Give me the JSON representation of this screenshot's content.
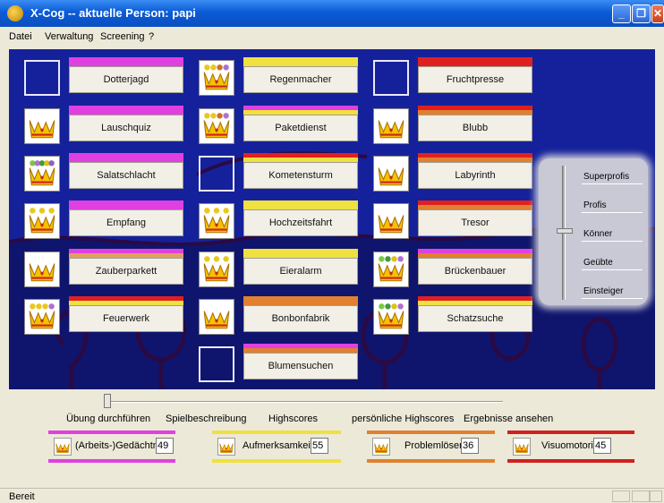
{
  "window": {
    "title": "X-Cog -- aktuelle Person: papi"
  },
  "menu": [
    "Datei",
    "Verwaltung",
    "Screening",
    "?"
  ],
  "games": [
    {
      "label": "Dotterjagd",
      "crown": false,
      "dots": [],
      "bars": [
        "#e040e0",
        "#e040e0"
      ]
    },
    {
      "label": "Lauschquiz",
      "crown": true,
      "dots": [],
      "bars": [
        "#e040e0",
        "#e040e0"
      ]
    },
    {
      "label": "Salatschlacht",
      "crown": true,
      "dots": [
        "#7ac943",
        "#b070d0",
        "#3c9c3c",
        "#e0c020",
        "#9060c0"
      ],
      "bars": [
        "#e040e0",
        "#e040e0"
      ]
    },
    {
      "label": "Empfang",
      "crown": true,
      "dots": [
        "#e8c820",
        "#e8c820",
        "#e8c820"
      ],
      "bars": [
        "#e040e0",
        "#e040e0"
      ]
    },
    {
      "label": "Zauberparkett",
      "crown": true,
      "dots": [],
      "bars": [
        "#e040e0",
        "#e0a060"
      ]
    },
    {
      "label": "Feuerwerk",
      "crown": true,
      "dots": [
        "#e8c820",
        "#e8c820",
        "#e8c820",
        "#b070d0"
      ],
      "bars": [
        "#e02020",
        "#f0e040"
      ]
    },
    {
      "label": "Regenmacher",
      "crown": true,
      "dots": [
        "#e8c820",
        "#e8c820",
        "#d07020",
        "#b070d0"
      ],
      "bars": [
        "#f0e040",
        "#f0e040"
      ]
    },
    {
      "label": "Paketdienst",
      "crown": true,
      "dots": [
        "#e8c820",
        "#e8c820",
        "#d07020",
        "#b070d0"
      ],
      "bars": [
        "#e040e0",
        "#f0e040"
      ]
    },
    {
      "label": "Kometensturm",
      "crown": false,
      "dots": [],
      "bars": [
        "#e02020",
        "#f0e040"
      ]
    },
    {
      "label": "Hochzeitsfahrt",
      "crown": true,
      "dots": [
        "#e8c820",
        "#e8c820",
        "#e8c820"
      ],
      "bars": [
        "#f0e040",
        "#f0e040"
      ]
    },
    {
      "label": "Eieralarm",
      "crown": true,
      "dots": [
        "#e8c820",
        "#e8c820",
        "#e8c820"
      ],
      "bars": [
        "#f0e040",
        "#f0e040"
      ]
    },
    {
      "label": "Bonbonfabrik",
      "crown": true,
      "dots": [],
      "bars": [
        "#e08030",
        "#e08030"
      ]
    },
    {
      "label": "Blumensuchen",
      "crown": false,
      "dots": [],
      "bars": [
        "#e040e0",
        "#e08030"
      ]
    },
    {
      "label": "Fruchtpresse",
      "crown": false,
      "dots": [],
      "bars": [
        "#e02020",
        "#e02020"
      ]
    },
    {
      "label": "Blubb",
      "crown": true,
      "dots": [],
      "bars": [
        "#e02020",
        "#e08030"
      ]
    },
    {
      "label": "Labyrinth",
      "crown": true,
      "dots": [],
      "bars": [
        "#e02020",
        "#e08030"
      ]
    },
    {
      "label": "Tresor",
      "crown": true,
      "dots": [],
      "bars": [
        "#e02020",
        "#e08030"
      ]
    },
    {
      "label": "Brückenbauer",
      "crown": true,
      "dots": [
        "#7ac943",
        "#3c9c3c",
        "#e0c020",
        "#b070d0"
      ],
      "bars": [
        "#e040e0",
        "#e08030"
      ]
    },
    {
      "label": "Schatzsuche",
      "crown": true,
      "dots": [
        "#7ac943",
        "#3c9c3c",
        "#e0c020",
        "#b070d0"
      ],
      "bars": [
        "#e02020",
        "#f0e040"
      ]
    }
  ],
  "levels": {
    "items": [
      "Superprofis",
      "Profis",
      "Könner",
      "Geübte",
      "Einsteiger"
    ],
    "selected": "Könner"
  },
  "actions": [
    "Übung durchführen",
    "Spielbeschreibung",
    "Highscores",
    "persönliche Highscores",
    "Ergebnisse ansehen"
  ],
  "categories": [
    {
      "name": "(Arbeits-)Gedächtnis",
      "value": "49",
      "color": "#e040e0"
    },
    {
      "name": "Aufmerksamkeit",
      "value": "55",
      "color": "#f0e040"
    },
    {
      "name": "Problemlösen",
      "value": "36",
      "color": "#e08030"
    },
    {
      "name": "Visuomotorik",
      "value": "45",
      "color": "#d02020"
    }
  ],
  "status": {
    "text": "Bereit"
  }
}
